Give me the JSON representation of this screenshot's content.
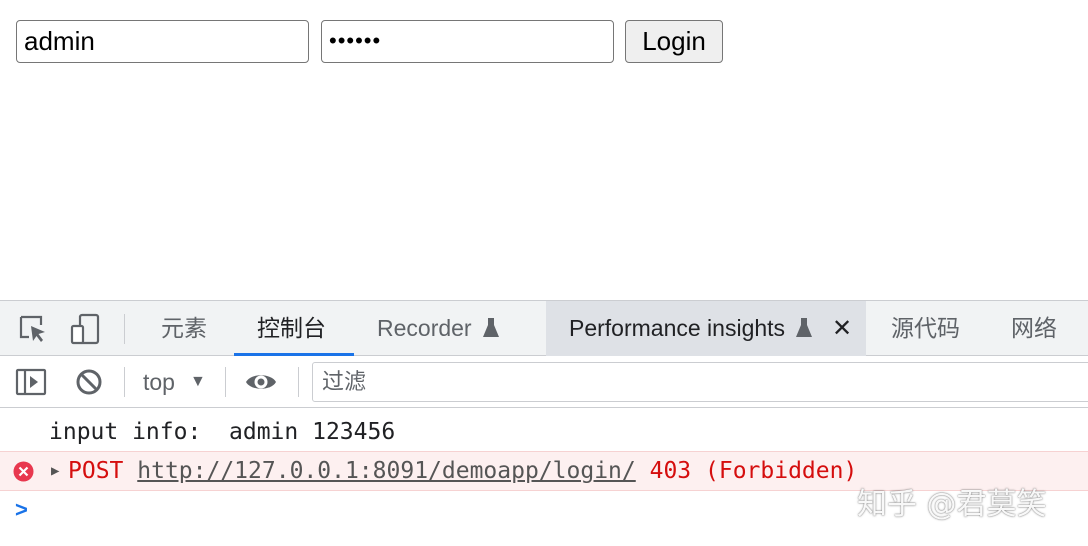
{
  "page": {
    "username_value": "admin",
    "password_value": "••••••",
    "login_button": "Login"
  },
  "devtools": {
    "tabs": [
      {
        "label": "元素",
        "active": false
      },
      {
        "label": "控制台",
        "active": true
      },
      {
        "label": "Recorder",
        "active": false,
        "icon": "flask-icon"
      },
      {
        "label": "Performance insights",
        "active": false,
        "icon": "flask-icon",
        "closable": true
      },
      {
        "label": "源代码",
        "active": false
      },
      {
        "label": "网络",
        "active": false
      }
    ],
    "tab_close_glyph": "✕",
    "toolbar": {
      "context": "top",
      "context_arrow": "▼",
      "filter_placeholder": "过滤"
    },
    "console": {
      "log_text": "input info:  admin 123456",
      "error": {
        "method": "POST",
        "url": "http://127.0.0.1:8091/demoapp/login/",
        "status": "403 (Forbidden)"
      },
      "expand_glyph": "▶",
      "prompt_glyph": ">"
    },
    "colors": {
      "accent": "#1a73e8",
      "error_text": "#d50e0e",
      "error_bg": "#fdf0f0"
    }
  },
  "watermark": "知乎 @君莫笑"
}
